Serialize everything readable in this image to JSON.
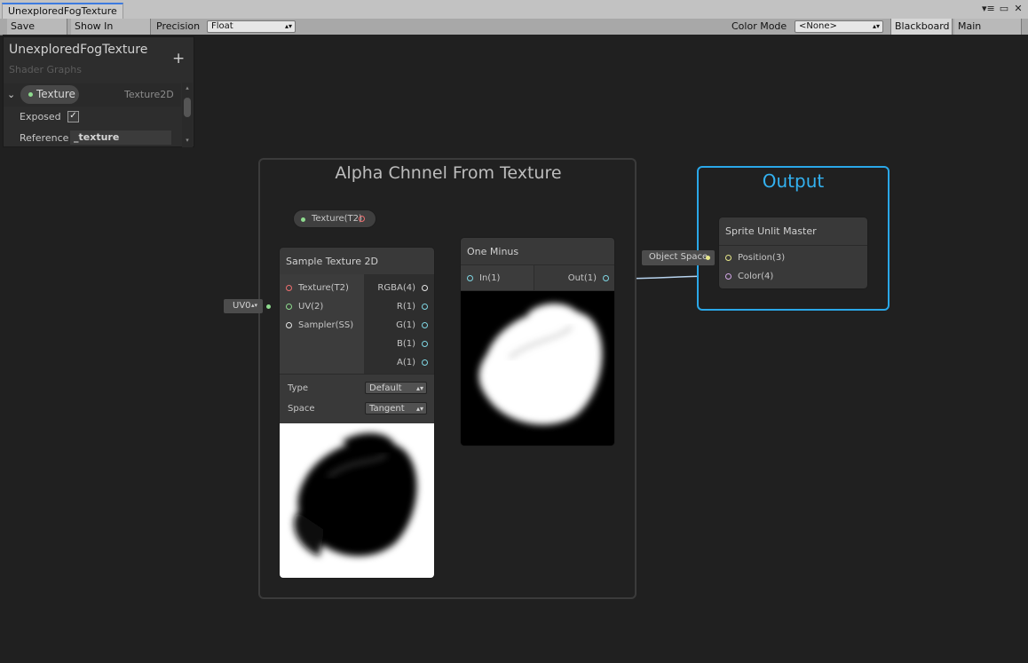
{
  "window": {
    "tab_title": "UnexploredFogTexture"
  },
  "toolbar": {
    "save_asset": "Save Asset",
    "show_in_project": "Show In Project",
    "precision_label": "Precision",
    "precision_value": "Float",
    "color_mode_label": "Color Mode",
    "color_mode_value": "<None>",
    "blackboard": "Blackboard",
    "main_preview": "Main Preview"
  },
  "blackboard": {
    "title": "UnexploredFogTexture",
    "subtitle": "Shader Graphs",
    "property": {
      "name": "Texture",
      "type": "Texture2D",
      "exposed_label": "Exposed",
      "exposed": true,
      "reference_label": "Reference",
      "reference_value": "_texture"
    }
  },
  "graph": {
    "group_title": "Alpha Chnnel From Texture",
    "property_node_label": "Texture(T2)",
    "uv_chip": "UV0",
    "sample_node": {
      "title": "Sample Texture 2D",
      "inputs": [
        "Texture(T2)",
        "UV(2)",
        "Sampler(SS)"
      ],
      "outputs": [
        "RGBA(4)",
        "R(1)",
        "G(1)",
        "B(1)",
        "A(1)"
      ],
      "type_label": "Type",
      "type_value": "Default",
      "space_label": "Space",
      "space_value": "Tangent"
    },
    "one_minus": {
      "title": "One Minus",
      "input": "In(1)",
      "output": "Out(1)"
    },
    "output_group_title": "Output",
    "master": {
      "title": "Sprite Unlit Master",
      "inputs": [
        "Position(3)",
        "Color(4)"
      ],
      "object_space_chip": "Object Space"
    }
  },
  "colors": {
    "output_border": "#2aa7e8",
    "wire_red": "#e07070",
    "wire_cyan": "#9fe3ee",
    "wire_pink": "#d4a8e8"
  }
}
